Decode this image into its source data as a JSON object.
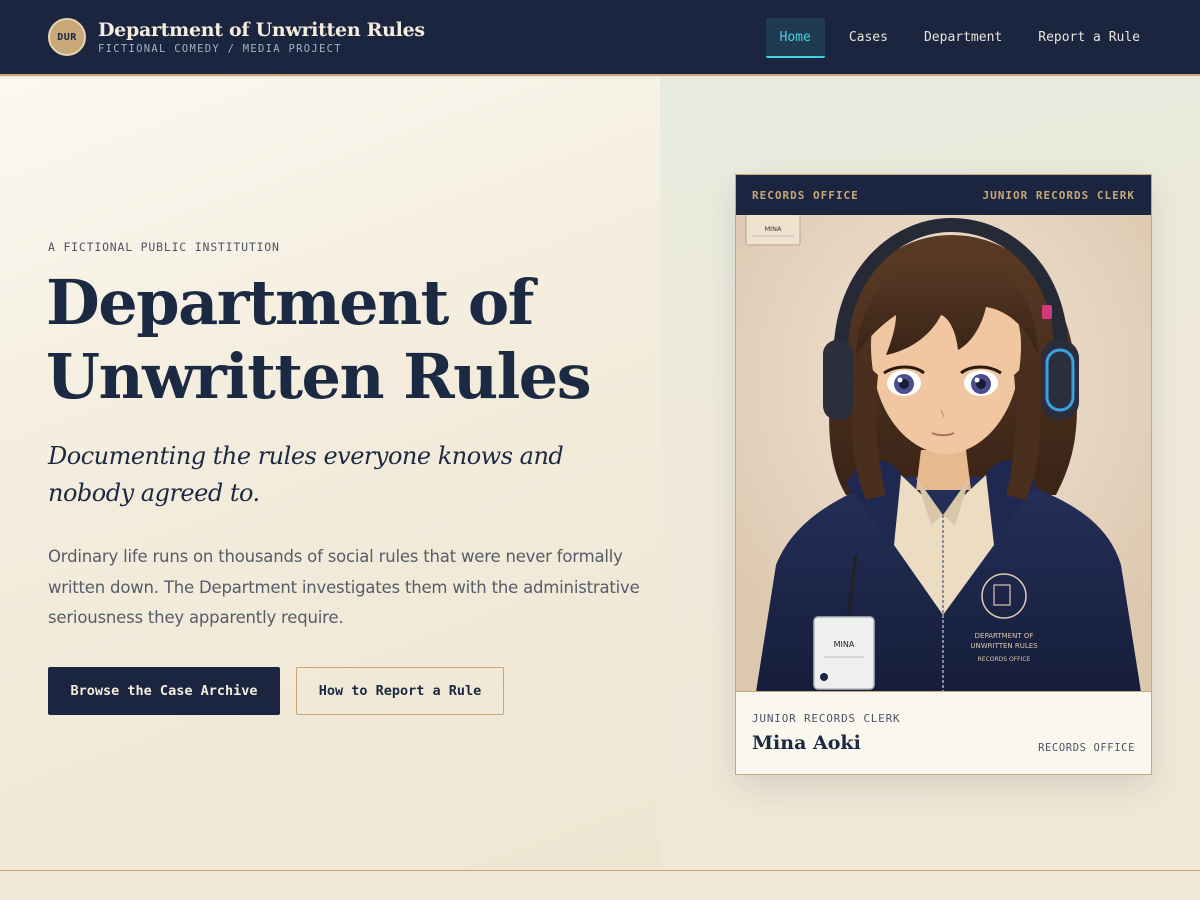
{
  "header": {
    "seal": "DUR",
    "title": "Department of Unwritten Rules",
    "subtitle": "FICTIONAL COMEDY / MEDIA PROJECT",
    "nav": [
      {
        "label": "Home",
        "active": true
      },
      {
        "label": "Cases"
      },
      {
        "label": "Department"
      },
      {
        "label": "Report a Rule"
      }
    ]
  },
  "hero": {
    "eyebrow": "A FICTIONAL PUBLIC INSTITUTION",
    "title_line1": "Department of",
    "title_line2": "Unwritten Rules",
    "tagline": "Documenting the rules everyone knows and nobody agreed to.",
    "body": "Ordinary life runs on thousands of social rules that were never formally written down. The Department investigates them with the administrative seriousness they apparently require.",
    "primary_button": "Browse the Case Archive",
    "secondary_button": "How to Report a Rule"
  },
  "card": {
    "header_left": "RECORDS OFFICE",
    "header_right": "JUNIOR RECORDS CLERK",
    "portrait_badge_name": "MINA",
    "role": "JUNIOR RECORDS CLERK",
    "name": "Mina Aoki",
    "office": "RECORDS OFFICE",
    "emblem_line1": "DEPARTMENT OF",
    "emblem_line2": "UNWRITTEN RULES",
    "emblem_line3": "RECORDS OFFICE"
  },
  "colors": {
    "navy": "#1b2540",
    "gold": "#c9a878",
    "teal_accent": "#43d3df",
    "cream": "#f1e9d6"
  }
}
